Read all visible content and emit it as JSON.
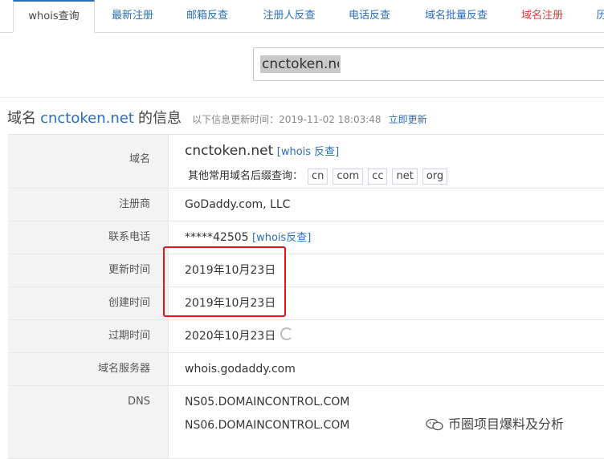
{
  "tabs": [
    {
      "label": "whois查询"
    },
    {
      "label": "最新注册"
    },
    {
      "label": "邮箱反查"
    },
    {
      "label": "注册人反查"
    },
    {
      "label": "电话反查"
    },
    {
      "label": "域名批量反查"
    },
    {
      "label": "域名注册"
    },
    {
      "label": "历"
    }
  ],
  "search": {
    "value": "cnctoken.net"
  },
  "header": {
    "prefix": "域名",
    "domain": "cnctoken.net",
    "suffix": "的信息",
    "updated_text": "以下信息更新时间：2019-11-02 18:03:48",
    "refresh_link": "立即更新"
  },
  "rows": {
    "domain": {
      "key": "域名",
      "value": "cnctoken.net",
      "link": "[whois 反查]",
      "other_label": "其他常用域名后缀查询：",
      "suffixes": [
        "cn",
        "com",
        "cc",
        "net",
        "org"
      ]
    },
    "registrar": {
      "key": "注册商",
      "value": "GoDaddy.com, LLC"
    },
    "phone": {
      "key": "联系电话",
      "value": "*****42505",
      "link": "[whois反查]"
    },
    "updated": {
      "key": "更新时间",
      "value": "2019年10月23日"
    },
    "created": {
      "key": "创建时间",
      "value": "2019年10月23日"
    },
    "expires": {
      "key": "过期时间",
      "value": "2020年10月23日"
    },
    "whois_server": {
      "key": "域名服务器",
      "value": "whois.godaddy.com"
    },
    "dns": {
      "key": "DNS",
      "values": [
        "NS05.DOMAINCONTROL.COM",
        "NS06.DOMAINCONTROL.COM"
      ]
    }
  },
  "watermark": {
    "text": "币圈项目爆料及分析"
  },
  "colors": {
    "link": "#2a6ebb",
    "highlight": "#e4161b",
    "red_tab": "#e4393c"
  }
}
